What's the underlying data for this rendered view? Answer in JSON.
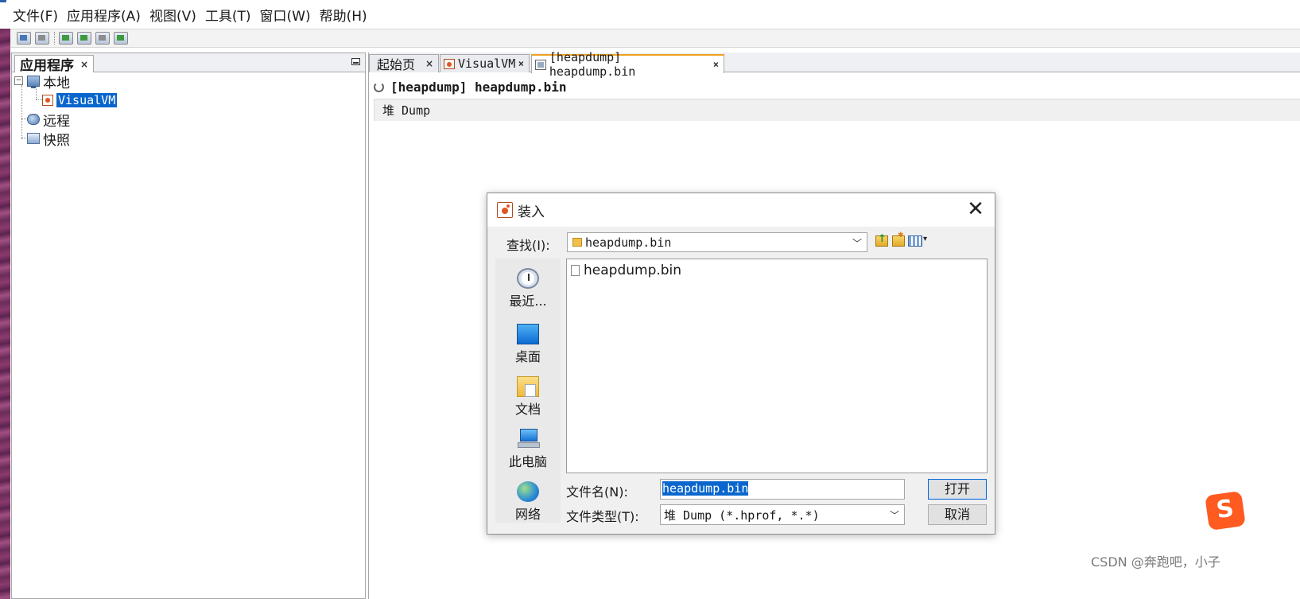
{
  "menu": [
    "文件(F)",
    "应用程序(A)",
    "视图(V)",
    "工具(T)",
    "窗口(W)",
    "帮助(H)"
  ],
  "left_panel": {
    "tab_label": "应用程序",
    "tree": {
      "local": "本地",
      "visualvm": "VisualVM",
      "remote": "远程",
      "snapshots": "快照"
    }
  },
  "editor": {
    "tabs": [
      {
        "label": "起始页"
      },
      {
        "label": "VisualVM"
      },
      {
        "label": "[heapdump] heapdump.bin"
      }
    ],
    "active_tab": 2,
    "doc_title": "[heapdump] heapdump.bin",
    "subtab": "堆 Dump"
  },
  "dialog": {
    "title": "装入",
    "look_in_label": "查找(I):",
    "look_in_value": "heapdump.bin",
    "places": [
      "最近...",
      "桌面",
      "文档",
      "此电脑",
      "网络"
    ],
    "files": [
      "heapdump.bin"
    ],
    "filename_label": "文件名(N):",
    "filename_value": "heapdump.bin",
    "filetype_label": "文件类型(T):",
    "filetype_value": "堆 Dump (*.hprof, *.*)",
    "open_button": "打开",
    "cancel_button": "取消"
  },
  "watermark": "CSDN @奔跑吧，小子",
  "tray_icon_letter": "S",
  "colors": {
    "selection": "#0a66cc",
    "active_tab_accent": "#f0a020",
    "desktop": "#6a2c5a"
  }
}
